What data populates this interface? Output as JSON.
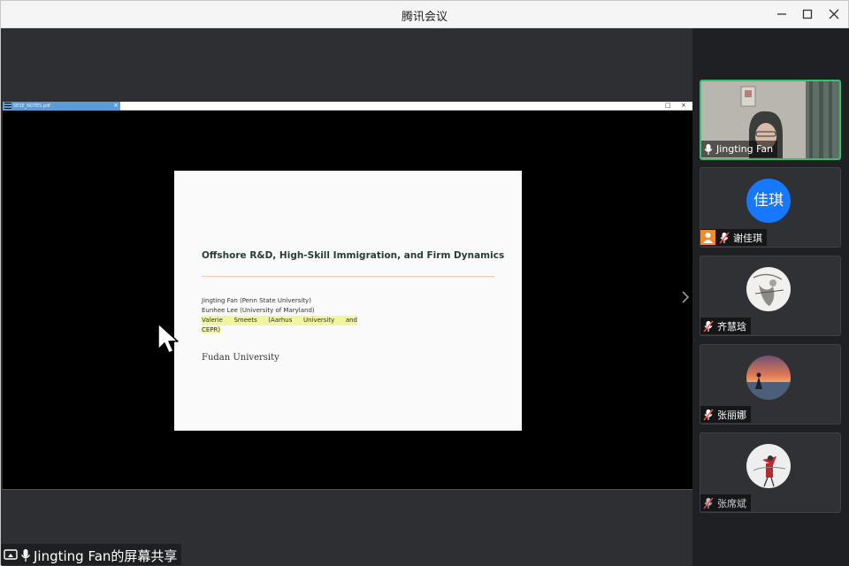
{
  "window": {
    "title": "腾讯会议"
  },
  "share": {
    "pdf_tab_label": "SESE_NOTES.pdf",
    "label": "Jingting Fan的屏幕共享"
  },
  "slide": {
    "title": "Offshore R&D, High-Skill Immigration, and Firm Dynamics",
    "authors": [
      "Jingting Fan (Penn State University)",
      "Eunhee Lee (University of Maryland)",
      "Valerie Smeets (Aarhus University and",
      "CEPR)"
    ],
    "affiliation": "Fudan University"
  },
  "participants": [
    {
      "name": "Jingting Fan",
      "type": "video",
      "speaking": true
    },
    {
      "name": "谢佳琪",
      "type": "text-avatar",
      "avatar_text": "佳琪",
      "host": true,
      "muted": true
    },
    {
      "name": "齐慧琀",
      "type": "image-avatar",
      "muted": true
    },
    {
      "name": "张丽娜",
      "type": "image-avatar",
      "muted": true
    },
    {
      "name": "张席斌",
      "type": "image-avatar",
      "muted": true
    }
  ],
  "colors": {
    "accent": "#1677ff",
    "active_border": "#37c06a",
    "host_badge": "#f08c2e"
  }
}
